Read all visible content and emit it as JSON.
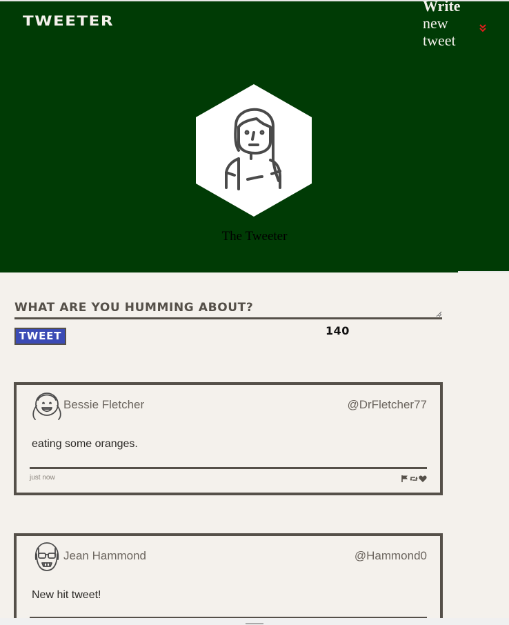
{
  "header": {
    "brand": "Tweeter",
    "compose_toggle": [
      "Write",
      "new",
      "tweet"
    ],
    "profile_name": "The Tweeter"
  },
  "composer": {
    "placeholder": "What are you humming about?",
    "submit_label": "Tweet",
    "counter": "140"
  },
  "tweets": [
    {
      "name": "Bessie Fletcher",
      "handle": "@DrFletcher77",
      "content": "eating some oranges.",
      "time": "just now",
      "avatar_icon": "smiling-girl-avatar-icon"
    },
    {
      "name": "Jean Hammond",
      "handle": "@Hammond0",
      "content": "New hit tweet!",
      "avatar_icon": "sunglasses-avatar-icon"
    }
  ],
  "colors": {
    "header_bg": "#003b05",
    "page_bg": "#f4f1ec",
    "ink": "#555049",
    "button_bg": "#3b4bb5",
    "chevron": "#e11d1d"
  }
}
